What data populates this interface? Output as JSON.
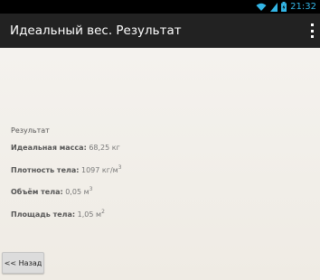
{
  "status_bar": {
    "time": "21:32"
  },
  "app_bar": {
    "title": "Идеальный вес. Результат"
  },
  "result": {
    "section_label": "Результат",
    "ideal_mass": {
      "label": "Идеальная масса:",
      "value": "68,25 кг"
    },
    "density": {
      "label": "Плотность тела:",
      "value": "1097 кг/м",
      "sup": "3"
    },
    "volume": {
      "label": "Объём тела:",
      "value": "0,05 м",
      "sup": "3"
    },
    "area": {
      "label": "Площадь тела:",
      "value": "1,05 м",
      "sup": "2"
    }
  },
  "back_button": {
    "label": "<< Назад"
  },
  "colors": {
    "accent": "#33b5e5",
    "appbar": "#222222",
    "background": "#f4f1ec"
  }
}
